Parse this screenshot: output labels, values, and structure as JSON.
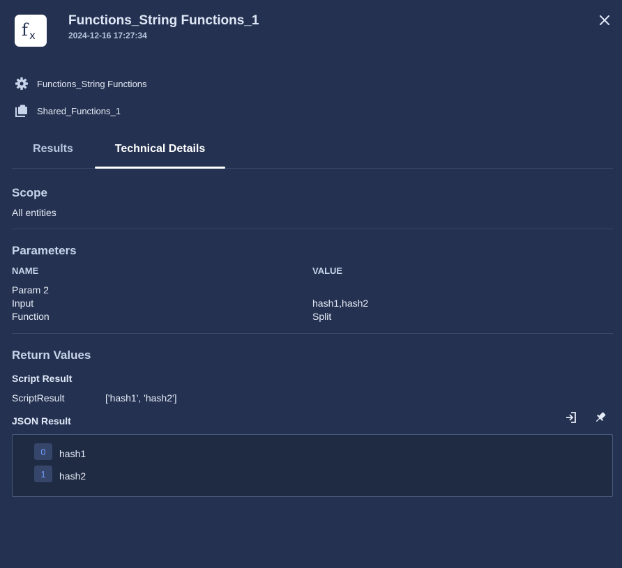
{
  "header": {
    "app_icon": "function-fx-icon",
    "title": "Functions_String Functions_1",
    "timestamp": "2024-12-16 17:27:34",
    "close_icon": "close-icon"
  },
  "meta": {
    "integration": {
      "icon": "gear-icon",
      "label": "Functions_String Functions"
    },
    "instance": {
      "icon": "shared-instance-icon",
      "label": "Shared_Functions_1"
    }
  },
  "tabs": [
    {
      "label": "Results",
      "active": false
    },
    {
      "label": "Technical Details",
      "active": true
    }
  ],
  "scope": {
    "title": "Scope",
    "value": "All entities"
  },
  "parameters": {
    "title": "Parameters",
    "headers": {
      "name": "NAME",
      "value": "VALUE"
    },
    "rows": [
      {
        "name": "Param 2",
        "value": ""
      },
      {
        "name": "Input",
        "value": "hash1,hash2"
      },
      {
        "name": "Function",
        "value": "Split"
      }
    ]
  },
  "return_values": {
    "title": "Return Values",
    "script_result": {
      "title": "Script Result",
      "key": "ScriptResult",
      "value": "['hash1', 'hash2']"
    },
    "json_result": {
      "title": "JSON Result",
      "items": [
        {
          "index": "0",
          "value": "hash1"
        },
        {
          "index": "1",
          "value": "hash2"
        }
      ]
    }
  },
  "colors": {
    "background": "#243150",
    "accent_index": "#6f9bff"
  }
}
